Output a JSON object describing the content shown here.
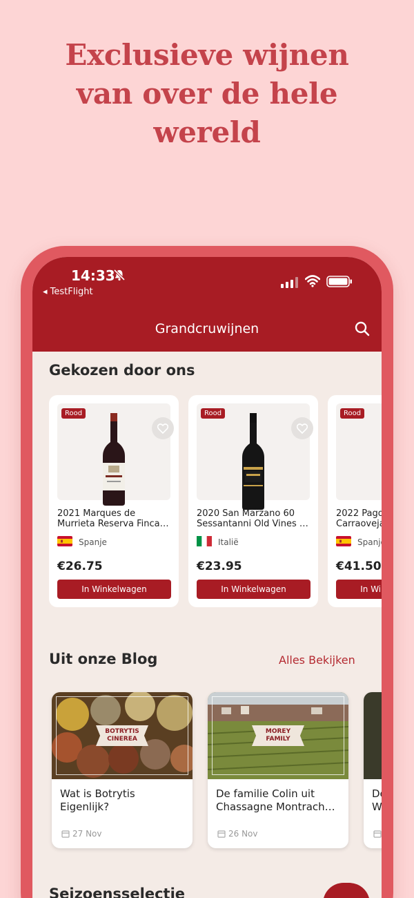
{
  "headline": [
    "Exclusieve wijnen",
    "van over de hele",
    "wereld"
  ],
  "status": {
    "time": "14:33",
    "back_app": "◂ TestFlight"
  },
  "app": {
    "title": "Grandcruwijnen"
  },
  "chosen": {
    "title": "Gekozen door ons",
    "wines": [
      {
        "tag": "Rood",
        "name1": "2021 Marques de",
        "name2": "Murrieta Reserva Finca…",
        "country": "Spanje",
        "flag": "spain",
        "price": "€26.75",
        "button": "In Winkelwagen"
      },
      {
        "tag": "Rood",
        "name1": "2020 San Marzano 60",
        "name2": "Sessantanni Old Vines …",
        "country": "Italië",
        "flag": "italy",
        "price": "€23.95",
        "button": "In Winkelwagen"
      },
      {
        "tag": "Rood",
        "name1": "2022 Pago",
        "name2": "Carraoveja…",
        "country": "Spanje",
        "flag": "spain",
        "price": "€41.50",
        "button": "In Winkelwagen"
      }
    ]
  },
  "blog": {
    "title": "Uit onze Blog",
    "see_all": "Alles Bekijken",
    "posts": [
      {
        "badge1": "BOTRYTIS",
        "badge2": "CINEREA",
        "title1": "Wat is Botrytis",
        "title2": "Eigenlijk?",
        "date": "27 Nov"
      },
      {
        "badge1": "MOREY",
        "badge2": "FAMILY",
        "title1": "De familie Colin uit",
        "title2": "Chassagne Montrach…",
        "date": "26 Nov"
      },
      {
        "badge1": "",
        "badge2": "",
        "title1": "De",
        "title2": "W",
        "date": ""
      }
    ]
  },
  "season": {
    "title": "Seizoensselectie"
  },
  "colors": {
    "brand": "#a81c24",
    "headline": "#c4434b",
    "background": "#fdd5d5"
  }
}
